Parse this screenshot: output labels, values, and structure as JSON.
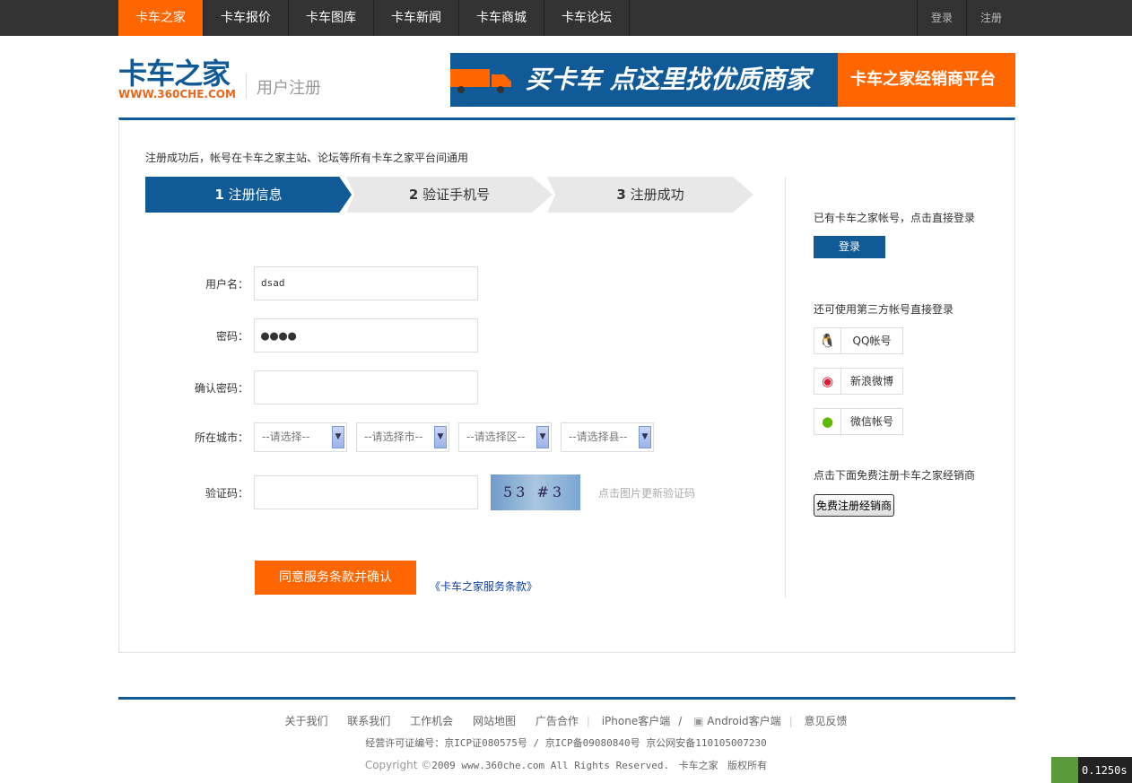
{
  "nav": {
    "items": [
      "卡车之家",
      "卡车报价",
      "卡车图库",
      "卡车新闻",
      "卡车商城",
      "卡车论坛"
    ],
    "login": "登录",
    "register": "注册"
  },
  "logo": {
    "cn": "卡车之家",
    "en": "WWW.360CHE.COM"
  },
  "page_title": "用户注册",
  "banner": {
    "left": "买卡车 点这里找优质商家",
    "right": "卡车之家经销商平台"
  },
  "note": "注册成功后，帐号在卡车之家主站、论坛等所有卡车之家平台间通用",
  "steps": [
    {
      "num": "1",
      "label": "注册信息"
    },
    {
      "num": "2",
      "label": "验证手机号"
    },
    {
      "num": "3",
      "label": "注册成功"
    }
  ],
  "form": {
    "username_label": "用户名：",
    "username_value": "dsad",
    "password_label": "密码：",
    "password_value": "●●●●",
    "confirm_label": "确认密码：",
    "city_label": "所在城市：",
    "selects": [
      "--请选择--",
      "--请选择市--",
      "--请选择区--",
      "--请选择县--"
    ],
    "captcha_label": "验证码：",
    "captcha_text": "53 #3",
    "captcha_hint": "点击图片更新验证码",
    "submit": "同意服务条款并确认",
    "terms": "《卡车之家服务条款》"
  },
  "side": {
    "have_account": "已有卡车之家帐号，点击直接登录",
    "login": "登录",
    "third_party": "还可使用第三方帐号直接登录",
    "qq": "QQ帐号",
    "weibo": "新浪微博",
    "wechat": "微信帐号",
    "dealer_note": "点击下面免费注册卡车之家经销商",
    "dealer_btn": "免费注册经销商"
  },
  "footer": {
    "links": [
      "关于我们",
      "联系我们",
      "工作机会",
      "网站地图",
      "广告合作"
    ],
    "iphone": "iPhone客户端",
    "android": "Android客户端",
    "feedback": "意见反馈",
    "license": "经营许可证编号：京ICP证080575号 / 京ICP备09080840号 京公网安备110105007230",
    "copyright": "Copyright ©",
    "copy_rest": "2009 www.360che.com All Rights Reserved.",
    "brand": "卡车之家",
    "rights": "版权所有"
  },
  "timer": "0.1250s"
}
